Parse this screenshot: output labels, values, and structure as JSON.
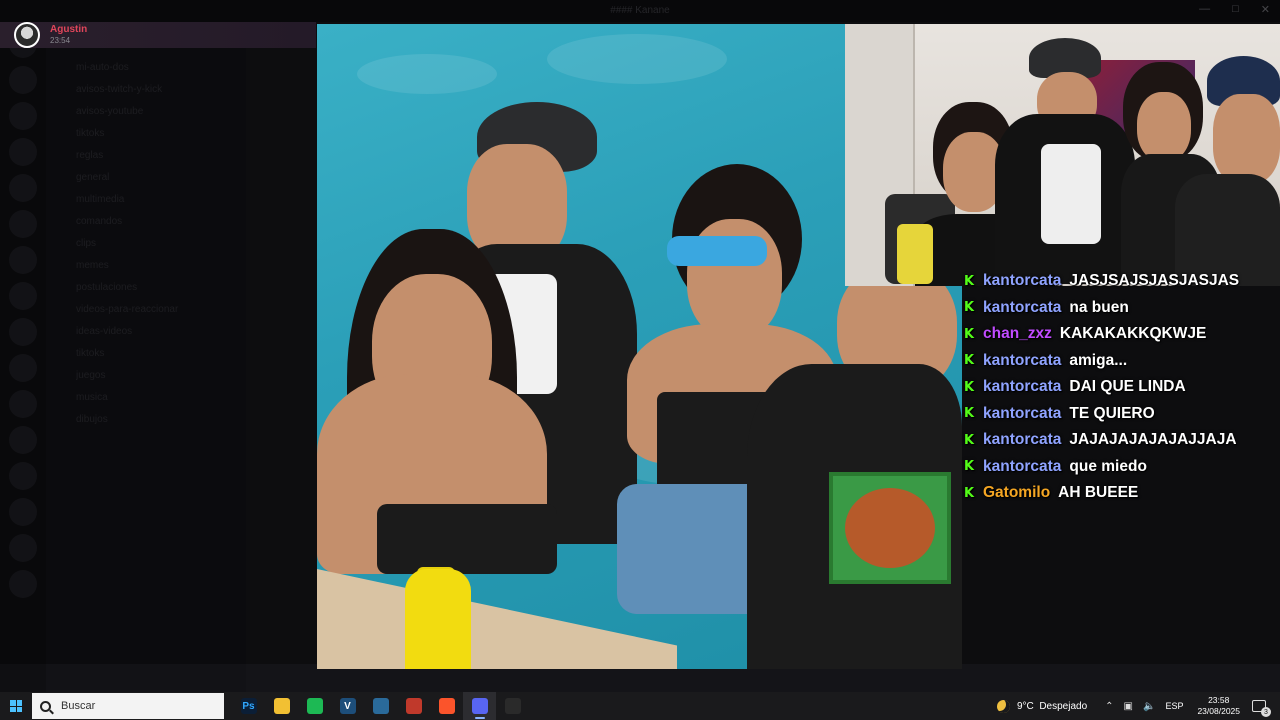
{
  "window": {
    "title": "#### Kanane"
  },
  "notification": {
    "author": "Agustin",
    "time": "23:54"
  },
  "background_channels": [
    "mi-auto-dos",
    "avisos-twitch-y-kick",
    "avisos-youtube",
    "tiktoks",
    "reglas",
    "general",
    "multimedia",
    "comandos",
    "clips",
    "memes",
    "postulaciones",
    "videos-para-reaccionar",
    "ideas-videos",
    "tiktoks",
    "juegos",
    "musica",
    "dibujos"
  ],
  "chat": {
    "badge": "K",
    "badge_color": "#53fc18",
    "messages": [
      {
        "user": "kantorcata",
        "color": "#8fa3ff",
        "text": "JASJSAJSJASJASJAS"
      },
      {
        "user": "kantorcata",
        "color": "#8fa3ff",
        "text": "na buen"
      },
      {
        "user": "chan_zxz",
        "color": "#c04bff",
        "text": "KAKAKAKKQKWJE"
      },
      {
        "user": "kantorcata",
        "color": "#8fa3ff",
        "text": "amiga..."
      },
      {
        "user": "kantorcata",
        "color": "#8fa3ff",
        "text": "DAI QUE LINDA"
      },
      {
        "user": "kantorcata",
        "color": "#8fa3ff",
        "text": "TE QUIERO"
      },
      {
        "user": "kantorcata",
        "color": "#8fa3ff",
        "text": "JAJAJAJAJAJAJJAJA"
      },
      {
        "user": "kantorcata",
        "color": "#8fa3ff",
        "text": "que miedo"
      },
      {
        "user": "Gatomilo",
        "color": "#f5a623",
        "text": "AH BUEEE"
      }
    ]
  },
  "taskbar": {
    "search_placeholder": "Buscar",
    "apps": [
      {
        "icon": "photoshop-icon",
        "label": "Ps",
        "color": "#0b1e36",
        "fg": "#31a8ff"
      },
      {
        "icon": "file-explorer-icon",
        "label": "",
        "color": "#f2c033",
        "fg": "#fff"
      },
      {
        "icon": "spotify-icon",
        "label": "",
        "color": "#1db954",
        "fg": "#fff"
      },
      {
        "icon": "vegas-icon",
        "label": "V",
        "color": "#1d4e7a",
        "fg": "#fff"
      },
      {
        "icon": "installer-icon",
        "label": "",
        "color": "#2a6a9a",
        "fg": "#fff"
      },
      {
        "icon": "shield-app-icon",
        "label": "",
        "color": "#c0392b",
        "fg": "#fff"
      },
      {
        "icon": "brave-icon",
        "label": "",
        "color": "#fb542b",
        "fg": "#fff"
      },
      {
        "icon": "discord-icon",
        "label": "",
        "color": "#5865f2",
        "fg": "#fff"
      },
      {
        "icon": "obs-icon",
        "label": "",
        "color": "#2a2a2a",
        "fg": "#fff"
      }
    ],
    "active_app_index": 7,
    "weather": {
      "temp": "9°C",
      "condition": "Despejado"
    },
    "language": "ESP",
    "time": "23:58",
    "date": "23/08/2025",
    "notification_count": "3"
  }
}
